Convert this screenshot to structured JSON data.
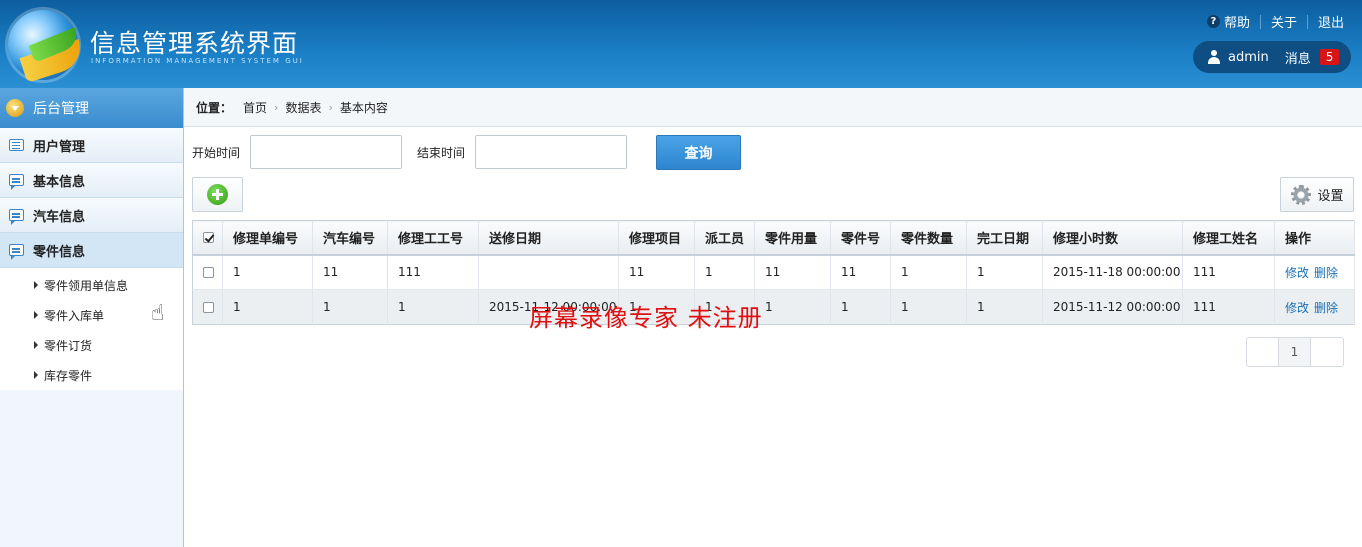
{
  "header": {
    "title": "信息管理系统界面",
    "subtitle": "INFORMATION MANAGEMENT SYSTEM GUI",
    "links": {
      "help": "帮助",
      "about": "关于",
      "logout": "退出"
    },
    "user": {
      "name": "admin",
      "messages_label": "消息",
      "messages_count": "5"
    }
  },
  "sidebar": {
    "title": "后台管理",
    "groups": [
      {
        "label": "用户管理"
      },
      {
        "label": "基本信息"
      },
      {
        "label": "汽车信息"
      },
      {
        "label": "零件信息"
      }
    ],
    "sub_items": [
      {
        "label": "零件领用单信息"
      },
      {
        "label": "零件入库单"
      },
      {
        "label": "零件订货"
      },
      {
        "label": "库存零件"
      }
    ]
  },
  "breadcrumb": {
    "lead": "位置：",
    "items": [
      "首页",
      "数据表",
      "基本内容"
    ]
  },
  "search": {
    "start_label": "开始时间",
    "end_label": "结束时间",
    "query_label": "查询"
  },
  "toolbar": {
    "settings_label": "设置"
  },
  "table": {
    "columns": [
      "修理单编号",
      "汽车编号",
      "修理工工号",
      "送修日期",
      "修理项目",
      "派工员",
      "零件用量",
      "零件号",
      "零件数量",
      "完工日期",
      "修理小时数",
      "修理工姓名",
      "操作"
    ],
    "rows": [
      {
        "cells": [
          "1",
          "11",
          "111",
          "",
          "11",
          "1",
          "11",
          "11",
          "1",
          "1",
          "2015-11-18 00:00:00",
          "111"
        ],
        "edit": "修改",
        "delete": "删除"
      },
      {
        "cells": [
          "1",
          "1",
          "1",
          "2015-11-12 00:00:00",
          "1",
          "1",
          "1",
          "1",
          "1",
          "1",
          "2015-11-12 00:00:00",
          "111"
        ],
        "edit": "修改",
        "delete": "删除"
      }
    ]
  },
  "watermark": "屏幕录像专家  未注册",
  "pager": {
    "current": "1"
  },
  "colors": {
    "header_blue": "#1b7fc5",
    "accent_blue": "#2e86cf",
    "badge_red": "#d81414",
    "link_blue": "#1a6fb5"
  }
}
